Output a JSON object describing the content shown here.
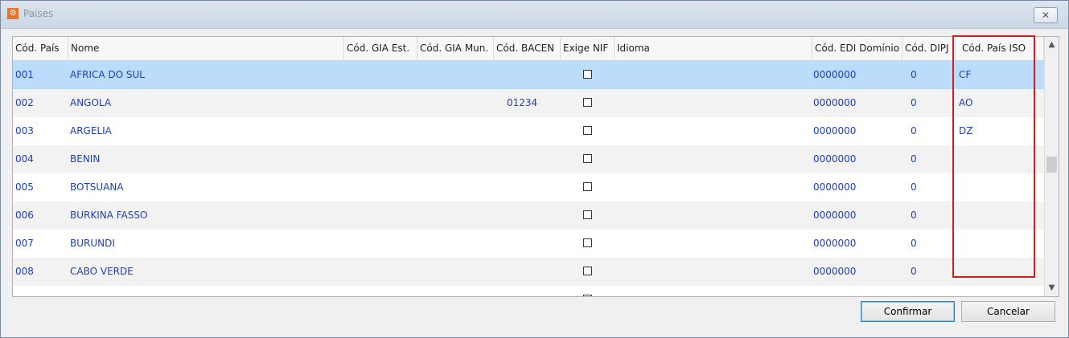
{
  "window": {
    "title": "Países",
    "close_label": "✕"
  },
  "grid": {
    "columns": [
      "Cód. País",
      "Nome",
      "Cód. GIA Est.",
      "Cód. GIA Mun.",
      "Cód. BACEN",
      "Exige NIF",
      "Idioma",
      "Cód. EDI Domínio",
      "Cód. DIPJ",
      "Cód. País ISO"
    ],
    "rows": [
      {
        "cod": "001",
        "nome": "AFRICA DO SUL",
        "bacen": "",
        "edi": "0000000",
        "dipj": "0",
        "iso": "CF",
        "selected": true
      },
      {
        "cod": "002",
        "nome": "ANGOLA",
        "bacen": "01234",
        "edi": "0000000",
        "dipj": "0",
        "iso": "AO",
        "selected": false
      },
      {
        "cod": "003",
        "nome": "ARGELIA",
        "bacen": "",
        "edi": "0000000",
        "dipj": "0",
        "iso": "DZ",
        "selected": false
      },
      {
        "cod": "004",
        "nome": "BENIN",
        "bacen": "",
        "edi": "0000000",
        "dipj": "0",
        "iso": "",
        "selected": false
      },
      {
        "cod": "005",
        "nome": "BOTSUANA",
        "bacen": "",
        "edi": "0000000",
        "dipj": "0",
        "iso": "",
        "selected": false
      },
      {
        "cod": "006",
        "nome": "BURKINA FASSO",
        "bacen": "",
        "edi": "0000000",
        "dipj": "0",
        "iso": "",
        "selected": false
      },
      {
        "cod": "007",
        "nome": "BURUNDI",
        "bacen": "",
        "edi": "0000000",
        "dipj": "0",
        "iso": "",
        "selected": false
      },
      {
        "cod": "008",
        "nome": "CABO VERDE",
        "bacen": "",
        "edi": "0000000",
        "dipj": "0",
        "iso": "",
        "selected": false
      }
    ]
  },
  "buttons": {
    "confirm_label": "Confirmar",
    "cancel_label": "Cancelar"
  },
  "colors": {
    "text_blue": "#1f3fb8",
    "selected_row": "#bcdcfb",
    "highlight": "#d31c1c"
  }
}
